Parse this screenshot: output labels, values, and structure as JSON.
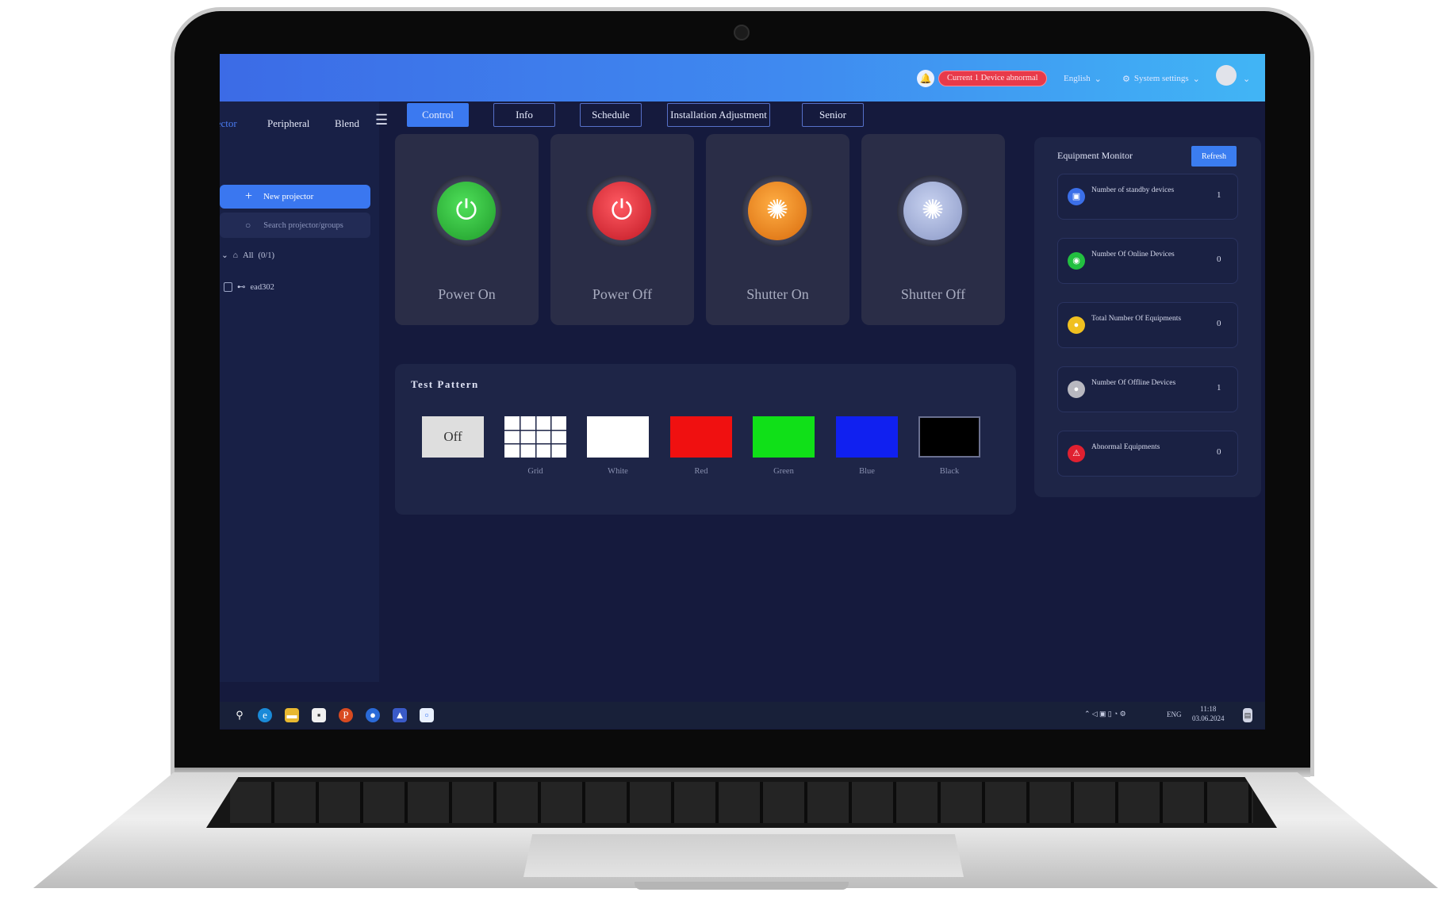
{
  "topbar": {
    "alert_text": "Current 1 Device abnormal",
    "language": "English",
    "settings_label": "System settings"
  },
  "sidebar": {
    "tabs": [
      "Projector",
      "Peripheral",
      "Blend"
    ],
    "new_button": "New projector",
    "search_placeholder": "Search projector/groups",
    "tree_root": "All",
    "tree_count": "(0/1)",
    "tree_item": "ead302"
  },
  "tabs": [
    "Control",
    "Info",
    "Schedule",
    "Installation Adjustment",
    "Senior"
  ],
  "controls": [
    {
      "label": "Power On",
      "color": "#2fbf3b"
    },
    {
      "label": "Power Off",
      "color": "#e0303c"
    },
    {
      "label": "Shutter On",
      "color": "#f08a1c"
    },
    {
      "label": "Shutter Off",
      "color": "#a8b4dc"
    }
  ],
  "test_pattern": {
    "title": "Test Pattern",
    "off_label": "Off",
    "swatches": [
      {
        "label": "Grid",
        "color": "#ffffff"
      },
      {
        "label": "White",
        "color": "#ffffff"
      },
      {
        "label": "Red",
        "color": "#f01010"
      },
      {
        "label": "Green",
        "color": "#10e018"
      },
      {
        "label": "Blue",
        "color": "#1020f0"
      },
      {
        "label": "Black",
        "color": "#000000"
      }
    ]
  },
  "monitor": {
    "title": "Equipment Monitor",
    "refresh": "Refresh",
    "items": [
      {
        "label": "Number of standby devices",
        "value": "1",
        "color": "#3b6fe8"
      },
      {
        "label": "Number Of Online Devices",
        "value": "0",
        "color": "#22c040"
      },
      {
        "label": "Total Number Of Equipments",
        "value": "0",
        "color": "#f0c020"
      },
      {
        "label": "Number Of Offline Devices",
        "value": "1",
        "color": "#b8b8c0"
      },
      {
        "label": "Abnormal Equipments",
        "value": "0",
        "color": "#e02030"
      }
    ]
  },
  "taskbar": {
    "language": "ENG",
    "time": "11:18",
    "date": "03.06.2024"
  }
}
